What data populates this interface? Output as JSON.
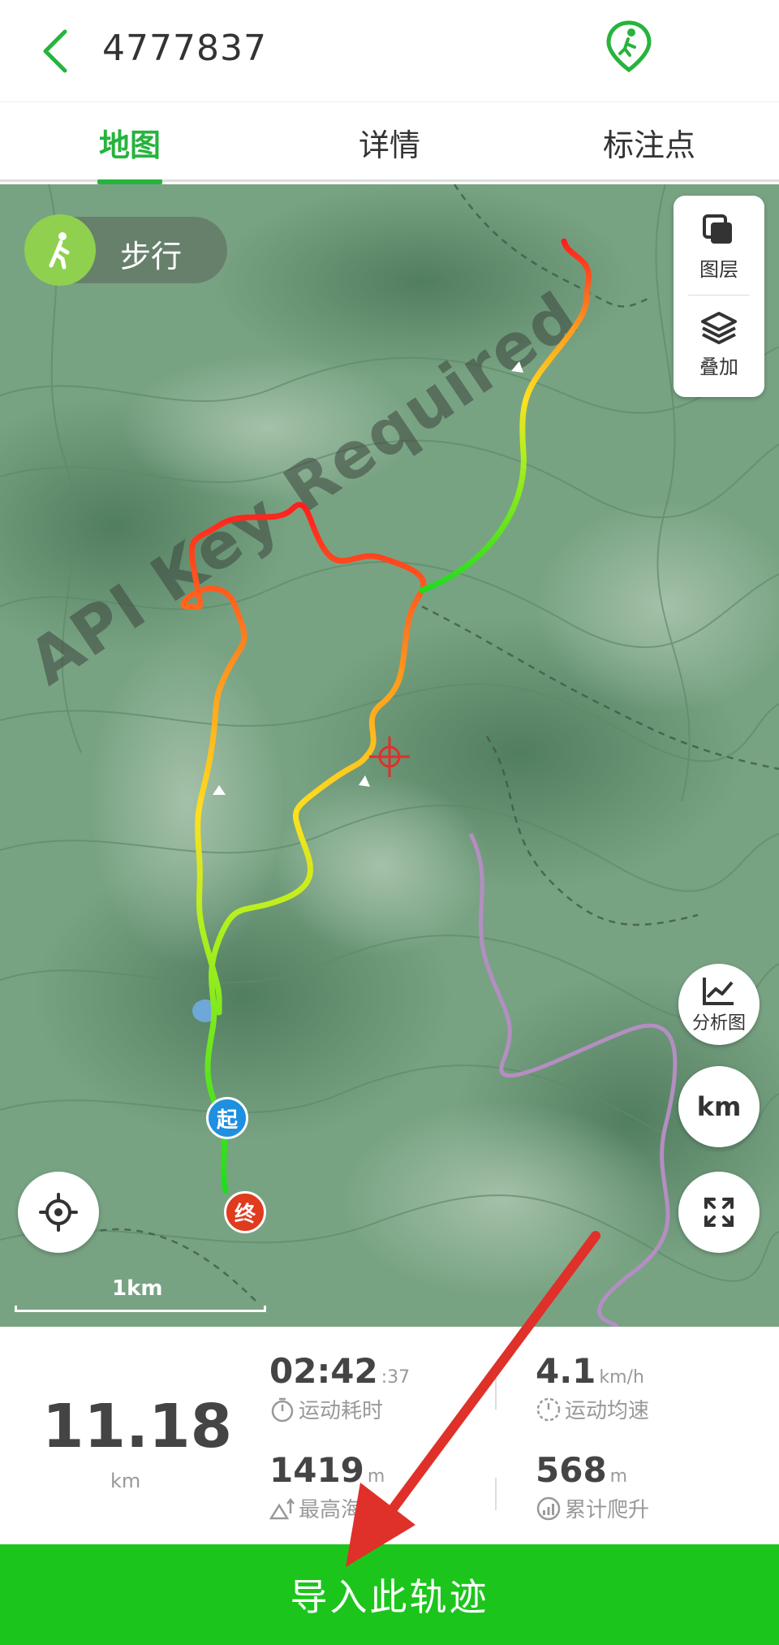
{
  "header": {
    "title": "4777837",
    "back_icon": "chevron-left-icon",
    "logo_icon": "hiker-pin-icon",
    "accent": "#27b33d"
  },
  "tabs": [
    {
      "label": "地图",
      "active": true
    },
    {
      "label": "详情",
      "active": false
    },
    {
      "label": "标注点",
      "active": false
    }
  ],
  "map": {
    "watermark": "API Key Required",
    "watermark_partial": "ed",
    "mode_label": "步行",
    "layers_label": "图层",
    "overlay_label": "叠加",
    "analysis_label": "分析图",
    "unit_button": "km",
    "scale_label": "1km",
    "start_marker": "起",
    "end_marker": "终",
    "start_color": "#1f8fe0",
    "end_color": "#e03a1f"
  },
  "stats": {
    "distance": "11.18",
    "distance_unit": "km",
    "duration": "02:42",
    "duration_sec": ":37",
    "duration_label": "运动耗时",
    "avg_speed": "4.1",
    "avg_speed_unit": "km/h",
    "avg_speed_label": "运动均速",
    "max_alt": "1419",
    "max_alt_unit": "m",
    "max_alt_label": "最高海拔",
    "climb": "568",
    "climb_unit": "m",
    "climb_label": "累计爬升"
  },
  "footer": {
    "import_label": "导入此轨迹",
    "button_color": "#1cc51c"
  },
  "annotation": {
    "arrow_color": "#e0302a"
  }
}
